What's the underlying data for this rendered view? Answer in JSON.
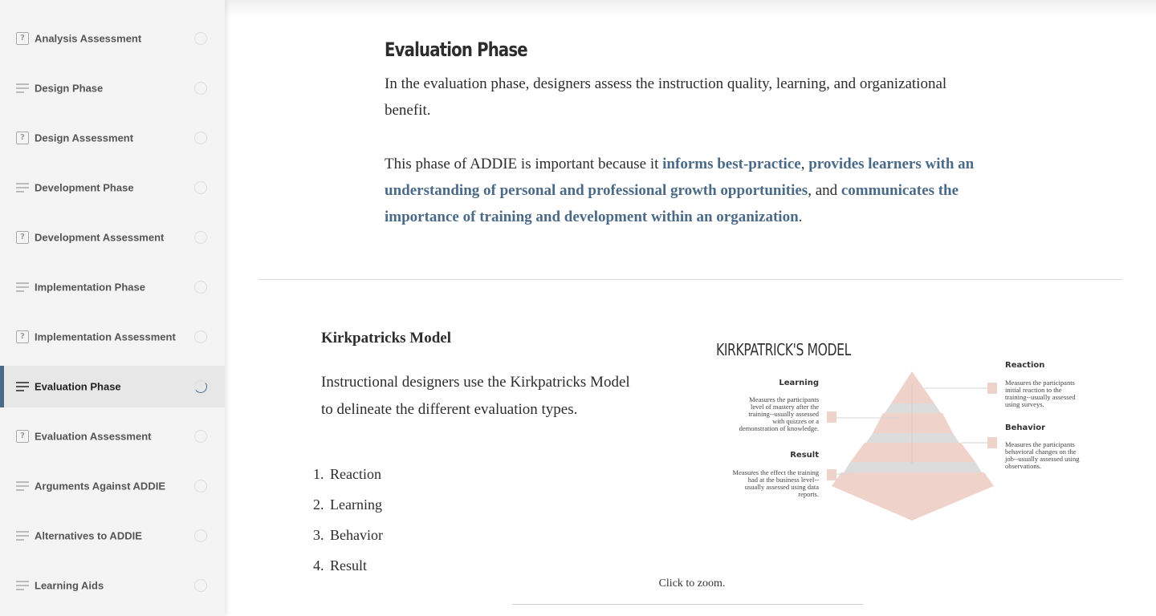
{
  "sidebar": {
    "items": [
      {
        "label": "Analysis Assessment",
        "type": "quiz",
        "icon": "quiz-icon",
        "status": "incomplete"
      },
      {
        "label": "Design Phase",
        "type": "lesson",
        "icon": "lesson-lines-icon",
        "status": "incomplete"
      },
      {
        "label": "Design Assessment",
        "type": "quiz",
        "icon": "quiz-icon",
        "status": "incomplete"
      },
      {
        "label": "Development Phase",
        "type": "lesson",
        "icon": "lesson-lines-icon",
        "status": "incomplete"
      },
      {
        "label": "Development Assessment",
        "type": "quiz",
        "icon": "quiz-icon",
        "status": "incomplete"
      },
      {
        "label": "Implementation Phase",
        "type": "lesson",
        "icon": "lesson-lines-icon",
        "status": "incomplete"
      },
      {
        "label": "Implementation Assessment",
        "type": "quiz",
        "icon": "quiz-icon",
        "status": "incomplete"
      },
      {
        "label": "Evaluation Phase",
        "type": "lesson",
        "icon": "lesson-lines-icon",
        "status": "in-progress",
        "active": true
      },
      {
        "label": "Evaluation Assessment",
        "type": "quiz",
        "icon": "quiz-icon",
        "status": "incomplete"
      },
      {
        "label": "Arguments Against ADDIE",
        "type": "lesson",
        "icon": "lesson-lines-icon",
        "status": "incomplete"
      },
      {
        "label": "Alternatives to ADDIE",
        "type": "lesson",
        "icon": "lesson-lines-icon",
        "status": "incomplete"
      },
      {
        "label": "Learning Aids",
        "type": "lesson",
        "icon": "lesson-lines-icon",
        "status": "incomplete"
      }
    ],
    "quiz_glyph": "?",
    "accent_color": "#4b6a88"
  },
  "main": {
    "title": "Evaluation Phase",
    "intro": "In the evaluation phase, designers assess the instruction quality, learning, and organizational benefit.",
    "importance": {
      "prefix": "This phase of ADDIE is important because it ",
      "link1": "informs best-practice",
      "sep1": ", ",
      "link2": "provides learners with an understanding of personal and professional growth opportunities",
      "sep2": ", and ",
      "link3": "communicates the importance of training and development within an organization",
      "suffix": "."
    },
    "link_color": "#4b6a88",
    "section_title": "Kirkpatricks Model",
    "section_body": "Instructional designers use the Kirkpatricks Model to delineate the different evaluation types.",
    "types": [
      {
        "num": "1.",
        "label": "Reaction"
      },
      {
        "num": "2.",
        "label": "Learning"
      },
      {
        "num": "3.",
        "label": "Behavior"
      },
      {
        "num": "4.",
        "label": "Result"
      }
    ],
    "figure": {
      "title": "KIRKPATRICK'S MODEL",
      "reaction_label": "Reaction",
      "reaction_desc": "Measures the participants initial reaction to the training--usually assessed using surveys.",
      "learning_label": "Learning",
      "learning_desc": "Measures the participants level of mastery after the training--usually assessed with quizzes or a demonstration of knowledge.",
      "behavior_label": "Behavior",
      "behavior_desc": "Measures the participants behavioral changes on the job--usually assessed using observations.",
      "result_label": "Result",
      "result_desc": "Measures the effect the training had at the business level--usually assessed using data reports.",
      "pyramid_color": "#efd3cb",
      "band_color": "#dcdcdc",
      "caption": "Click to zoom."
    }
  }
}
